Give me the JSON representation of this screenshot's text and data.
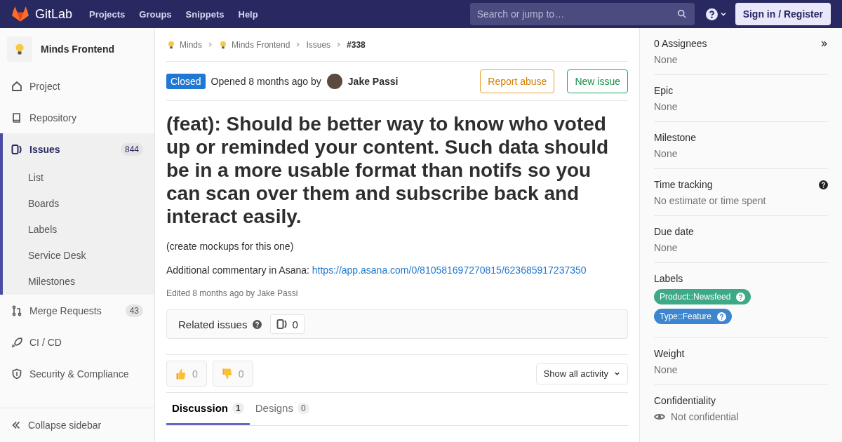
{
  "header": {
    "brand": "GitLab",
    "nav": [
      "Projects",
      "Groups",
      "Snippets",
      "Help"
    ],
    "search": {
      "placeholder": "Search or jump to…"
    },
    "sign_in": "Sign in / Register"
  },
  "sidebar": {
    "project": "Minds Frontend",
    "items": [
      {
        "label": "Project",
        "selected": false
      },
      {
        "label": "Repository",
        "selected": false
      },
      {
        "label": "Issues",
        "selected": true,
        "count": "844",
        "children": [
          {
            "label": "List"
          },
          {
            "label": "Boards"
          },
          {
            "label": "Labels"
          },
          {
            "label": "Service Desk"
          },
          {
            "label": "Milestones"
          }
        ]
      },
      {
        "label": "Merge Requests",
        "selected": false,
        "count": "43"
      },
      {
        "label": "CI / CD",
        "selected": false
      },
      {
        "label": "Security & Compliance",
        "selected": false
      }
    ],
    "collapse": "Collapse sidebar"
  },
  "breadcrumbs": [
    {
      "label": "Minds",
      "avatar": true
    },
    {
      "label": "Minds Frontend",
      "avatar": true
    },
    {
      "label": "Issues",
      "avatar": false
    },
    {
      "label": "#338",
      "avatar": false
    }
  ],
  "issue": {
    "status": "Closed",
    "opened": "Opened 8 months ago by",
    "author": "Jake Passi",
    "actions": [
      "Report abuse",
      "New issue"
    ],
    "title": "(feat): Should be better way to know who voted up or reminded your content. Such data should be in a more usable format than notifs so you can scan over them and subscribe back and interact easily.",
    "paragraphs": [
      {
        "text": "(create mockups for this one)"
      },
      {
        "text": "Additional commentary in Asana: ",
        "link": "https://app.asana.com/0/810581697270815/623685917237350"
      }
    ],
    "edited": "Edited 8 months ago by Jake Passi",
    "related": {
      "label": "Related issues",
      "count": "0"
    },
    "awards": [
      {
        "kind": "up",
        "count": "0"
      },
      {
        "kind": "down",
        "count": "0"
      }
    ],
    "activity_filter": "Show all activity",
    "tabs": [
      {
        "label": "Discussion",
        "count": "1",
        "selected": true
      },
      {
        "label": "Designs",
        "count": "0",
        "selected": false
      }
    ]
  },
  "right_sidebar": {
    "sections": [
      {
        "title": "0 Assignees",
        "value": "None"
      },
      {
        "title": "Epic",
        "value": "None"
      },
      {
        "title": "Milestone",
        "value": "None"
      },
      {
        "title": "Time tracking",
        "value": "No estimate or time spent"
      },
      {
        "title": "Due date",
        "value": "None"
      },
      {
        "title": "Labels",
        "labels": [
          {
            "text": "Product::Newsfeed",
            "color": "#3ea987"
          },
          {
            "text": "Type::Feature",
            "color": "#3b86cf"
          }
        ]
      },
      {
        "title": "Weight",
        "value": "None"
      },
      {
        "title": "Confidentiality",
        "value": "Not confidential"
      }
    ]
  }
}
